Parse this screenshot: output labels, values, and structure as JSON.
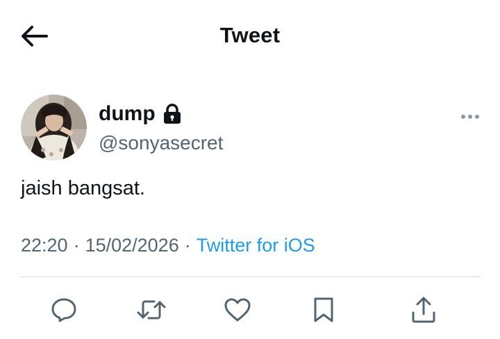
{
  "header": {
    "title": "Tweet",
    "back_icon": "arrow-left-icon"
  },
  "tweet": {
    "author": {
      "display_name": "dump",
      "handle": "@sonyasecret",
      "protected_icon": "lock-icon"
    },
    "text": "jaish bangsat.",
    "time": "22:20",
    "date": "15/02/2026",
    "separator": "·",
    "source": "Twitter for iOS"
  },
  "actions": [
    {
      "name": "reply",
      "icon": "reply-bubble-icon"
    },
    {
      "name": "retweet",
      "icon": "retweet-icon"
    },
    {
      "name": "like",
      "icon": "heart-icon"
    },
    {
      "name": "bookmark",
      "icon": "bookmark-icon"
    },
    {
      "name": "share",
      "icon": "share-upload-icon"
    }
  ],
  "colors": {
    "text_primary": "#0f1419",
    "text_secondary": "#536471",
    "link": "#1d9bf0",
    "divider": "#cfd9de",
    "icon": "#536471"
  }
}
